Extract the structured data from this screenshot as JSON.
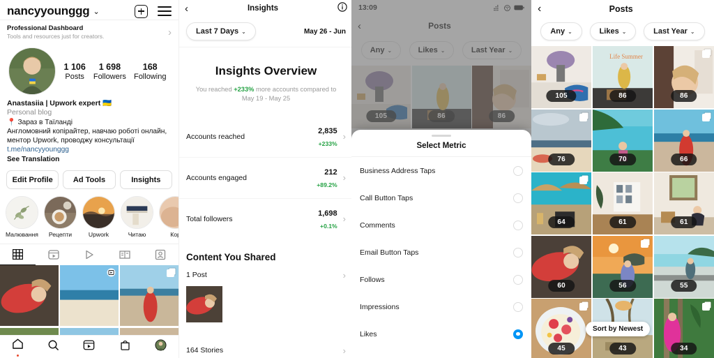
{
  "profile": {
    "username": "nancyyounggg",
    "username_caret": "⌄",
    "dashboard": {
      "title": "Professional Dashboard",
      "subtitle": "Tools and resources just for creators.",
      "chevron": "›"
    },
    "stats": [
      {
        "number": "1 106",
        "label": "Posts"
      },
      {
        "number": "1 698",
        "label": "Followers"
      },
      {
        "number": "168",
        "label": "Following"
      }
    ],
    "display_name": "Anastasiia | Upwork expert 🇺🇦",
    "category": "Personal blog",
    "bio_lines": [
      "📍 Зараз в Таїланді",
      "Англомовний копірайтер, навчаю роботі онлайн,",
      "ментор Upwork, проводжу консультації"
    ],
    "link": "t.me/nancyyounggg",
    "see_translation": "See Translation",
    "actions": [
      "Edit Profile",
      "Ad Tools",
      "Insights"
    ],
    "highlights": [
      {
        "label": "Малювання"
      },
      {
        "label": "Рецепти"
      },
      {
        "label": "Upwork"
      },
      {
        "label": "Читаю"
      },
      {
        "label": "Кор"
      }
    ],
    "tabs": [
      "grid-tab",
      "reels-tab",
      "video-tab",
      "guides-tab",
      "tagged-tab"
    ],
    "nav": [
      "home-icon",
      "search-icon",
      "reels-icon",
      "shop-icon",
      "profile-avatar"
    ]
  },
  "insights": {
    "back": "‹",
    "title": "Insights",
    "info_icon": "i",
    "range_chip": "Last 7 Days",
    "caret": "⌄",
    "date_range": "May 26 - Jun",
    "overview_title": "Insights Overview",
    "overview_sub_pre": "You reached ",
    "overview_sub_pct": "+233%",
    "overview_sub_post": " more accounts compared to May 19 - May 25",
    "metrics": [
      {
        "label": "Accounts reached",
        "value": "2,835",
        "delta": "+233%",
        "chevron": "›"
      },
      {
        "label": "Accounts engaged",
        "value": "212",
        "delta": "+89.2%",
        "chevron": "›"
      },
      {
        "label": "Total followers",
        "value": "1,698",
        "delta": "+0.1%",
        "chevron": "›"
      }
    ],
    "section_title": "Content You Shared",
    "rows": [
      {
        "label": "1 Post",
        "chevron": "›"
      },
      {
        "label": "164 Stories",
        "chevron": "›"
      }
    ]
  },
  "posts_dimmed": {
    "status_time": "13:09",
    "back": "‹",
    "title": "Posts",
    "filters": [
      {
        "label": "Any",
        "caret": "⌄"
      },
      {
        "label": "Likes",
        "caret": "⌄"
      },
      {
        "label": "Last Year",
        "caret": "⌄"
      }
    ],
    "likes": [
      "105",
      "86",
      "86"
    ],
    "sheet": {
      "title": "Select Metric",
      "options": [
        {
          "label": "Business Address Taps",
          "selected": false
        },
        {
          "label": "Call Button Taps",
          "selected": false
        },
        {
          "label": "Comments",
          "selected": false
        },
        {
          "label": "Email Button Taps",
          "selected": false
        },
        {
          "label": "Follows",
          "selected": false
        },
        {
          "label": "Impressions",
          "selected": false
        },
        {
          "label": "Likes",
          "selected": true
        }
      ]
    }
  },
  "posts_grid": {
    "back": "‹",
    "title": "Posts",
    "filters": [
      {
        "label": "Any",
        "caret": "⌄"
      },
      {
        "label": "Likes",
        "caret": "⌄"
      },
      {
        "label": "Last Year",
        "caret": "⌄"
      }
    ],
    "tooltip": "Sort by Newest",
    "cells": [
      {
        "likes": "105",
        "multi": false
      },
      {
        "likes": "86",
        "multi": false
      },
      {
        "likes": "86",
        "multi": true
      },
      {
        "likes": "76",
        "multi": true
      },
      {
        "likes": "70",
        "multi": false
      },
      {
        "likes": "66",
        "multi": true
      },
      {
        "likes": "64",
        "multi": true
      },
      {
        "likes": "61",
        "multi": false
      },
      {
        "likes": "61",
        "multi": false
      },
      {
        "likes": "60",
        "multi": false
      },
      {
        "likes": "56",
        "multi": true
      },
      {
        "likes": "55",
        "multi": false
      },
      {
        "likes": "45",
        "multi": true
      },
      {
        "likes": "43",
        "multi": false
      },
      {
        "likes": "34",
        "multi": true
      }
    ]
  },
  "colors": {
    "accent_blue": "#0095f6",
    "green": "#25a244",
    "link": "#2b5f8e",
    "muted": "#8e8e8e"
  }
}
